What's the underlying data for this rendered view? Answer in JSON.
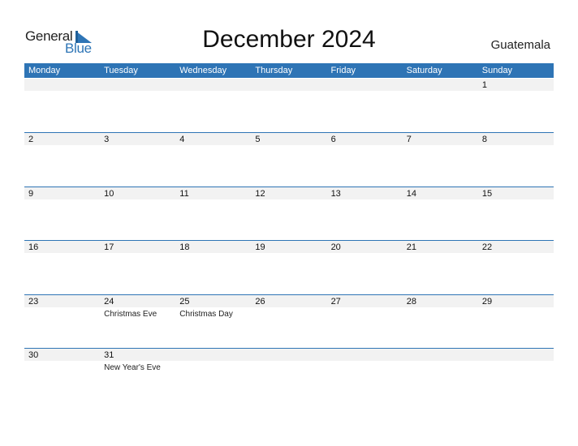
{
  "logo": {
    "line1": "General",
    "line2": "Blue"
  },
  "title": "December 2024",
  "country": "Guatemala",
  "colors": {
    "accent": "#2e74b5",
    "strip": "#f2f2f2"
  },
  "weekdays": [
    "Monday",
    "Tuesday",
    "Wednesday",
    "Thursday",
    "Friday",
    "Saturday",
    "Sunday"
  ],
  "weeks": [
    [
      {
        "d": ""
      },
      {
        "d": ""
      },
      {
        "d": ""
      },
      {
        "d": ""
      },
      {
        "d": ""
      },
      {
        "d": ""
      },
      {
        "d": "1"
      }
    ],
    [
      {
        "d": "2"
      },
      {
        "d": "3"
      },
      {
        "d": "4"
      },
      {
        "d": "5"
      },
      {
        "d": "6"
      },
      {
        "d": "7"
      },
      {
        "d": "8"
      }
    ],
    [
      {
        "d": "9"
      },
      {
        "d": "10"
      },
      {
        "d": "11"
      },
      {
        "d": "12"
      },
      {
        "d": "13"
      },
      {
        "d": "14"
      },
      {
        "d": "15"
      }
    ],
    [
      {
        "d": "16"
      },
      {
        "d": "17"
      },
      {
        "d": "18"
      },
      {
        "d": "19"
      },
      {
        "d": "20"
      },
      {
        "d": "21"
      },
      {
        "d": "22"
      }
    ],
    [
      {
        "d": "23"
      },
      {
        "d": "24",
        "e": "Christmas Eve"
      },
      {
        "d": "25",
        "e": "Christmas Day"
      },
      {
        "d": "26"
      },
      {
        "d": "27"
      },
      {
        "d": "28"
      },
      {
        "d": "29"
      }
    ],
    [
      {
        "d": "30"
      },
      {
        "d": "31",
        "e": "New Year's Eve"
      },
      {
        "d": ""
      },
      {
        "d": ""
      },
      {
        "d": ""
      },
      {
        "d": ""
      },
      {
        "d": ""
      }
    ]
  ]
}
